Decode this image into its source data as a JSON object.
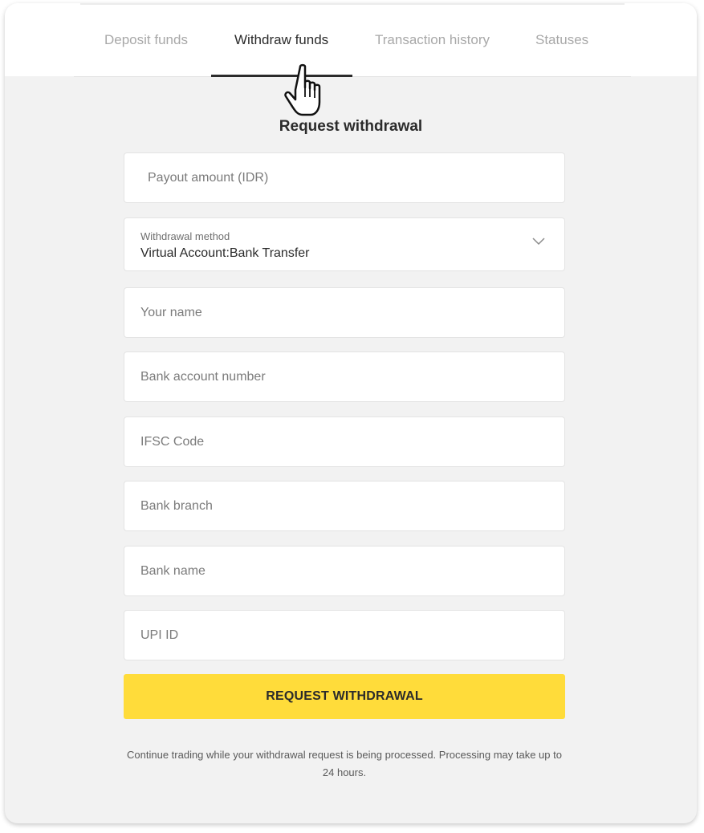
{
  "tabs": [
    {
      "label": "Deposit funds",
      "active": false
    },
    {
      "label": "Withdraw funds",
      "active": true
    },
    {
      "label": "Transaction history",
      "active": false
    },
    {
      "label": "Statuses",
      "active": false
    }
  ],
  "form": {
    "title": "Request withdrawal",
    "payout_amount_placeholder": "Payout amount (IDR)",
    "withdrawal_method": {
      "label": "Withdrawal method",
      "value": "Virtual Account:Bank Transfer"
    },
    "name_placeholder": "Your name",
    "account_number_placeholder": "Bank account number",
    "ifsc_placeholder": "IFSC Code",
    "branch_placeholder": "Bank branch",
    "bank_name_placeholder": "Bank name",
    "upi_placeholder": "UPI ID",
    "submit_label": "REQUEST WITHDRAWAL",
    "note": "Continue trading while your withdrawal request is being processed.  Processing may take up to 24 hours."
  },
  "icons": {
    "dropdown": "chevron-down-icon",
    "cursor": "hand-pointer-icon"
  },
  "colors": {
    "accent": "#ffdc3a",
    "active_tab": "#2b2b2b",
    "inactive_tab": "#a8a8a8"
  }
}
